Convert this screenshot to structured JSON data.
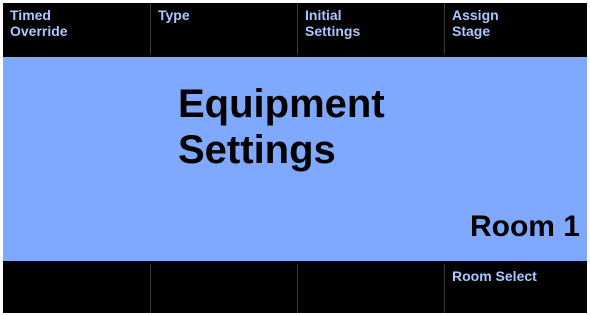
{
  "top_softkeys": [
    {
      "label": "Timed\nOverride"
    },
    {
      "label": "Type"
    },
    {
      "label": "Initial\nSettings"
    },
    {
      "label": "Assign\nStage"
    }
  ],
  "main": {
    "title": "Equipment\nSettings",
    "room_label": "Room 1"
  },
  "bottom_softkeys": [
    {
      "label": ""
    },
    {
      "label": ""
    },
    {
      "label": ""
    },
    {
      "label": "Room Select"
    }
  ],
  "colors": {
    "background": "#000000",
    "panel": "#7fa8ff",
    "softkey_text": "#a9c8ff",
    "main_text": "#000000"
  }
}
